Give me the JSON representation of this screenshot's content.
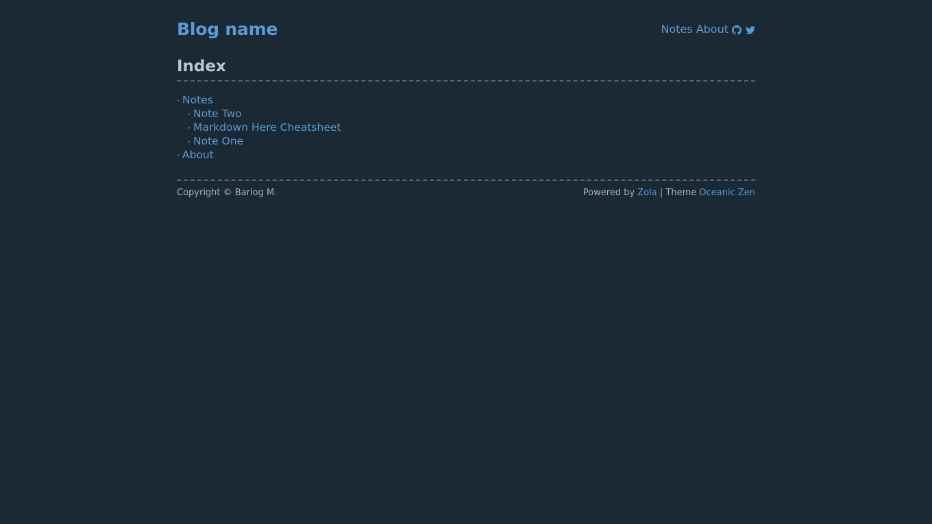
{
  "header": {
    "blog_name": "Blog name",
    "nav": [
      {
        "label": "Notes"
      },
      {
        "label": "About"
      }
    ],
    "icons": [
      "github-icon",
      "twitter-icon"
    ]
  },
  "main": {
    "title": "Index",
    "bullet": "·",
    "items": [
      {
        "label": "Notes",
        "children": [
          {
            "label": "Note Two"
          },
          {
            "label": "Markdown Here Cheatsheet"
          },
          {
            "label": "Note One"
          }
        ]
      },
      {
        "label": "About"
      }
    ]
  },
  "footer": {
    "copyright": "Copyright © Barlog M.",
    "powered_by": "Powered by",
    "zola": "Zola",
    "separator": "| Theme",
    "theme": "Oceanic Zen"
  },
  "colors": {
    "background": "#1b2934",
    "link": "#5b9bd5",
    "text": "#c0c5ce"
  }
}
